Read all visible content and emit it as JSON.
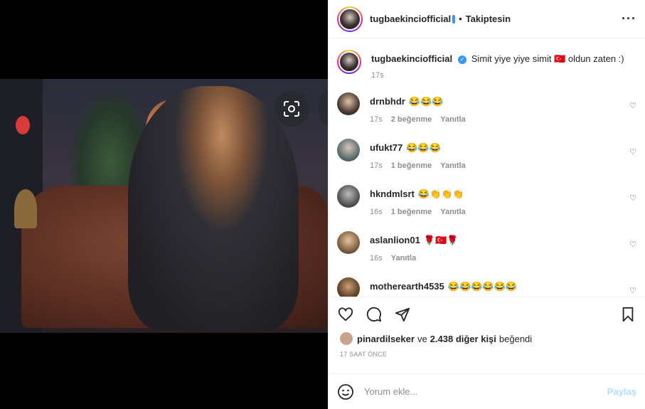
{
  "header": {
    "username": "tugbaekinciofficial",
    "follow_status": "Takiptesin",
    "separator": "•"
  },
  "caption": {
    "username": "tugbaekinciofficial",
    "text": "Simit yiye yiye simit 🇹🇷 oldun zaten :)",
    "time": "17s"
  },
  "comments": [
    {
      "username": "drnbhdr",
      "text": "😂😂😂",
      "time": "17s",
      "likes": "2 beğenme",
      "reply": "Yanıtla"
    },
    {
      "username": "ufukt77",
      "text": "😂😂😂",
      "time": "17s",
      "likes": "1 beğenme",
      "reply": "Yanıtla"
    },
    {
      "username": "hkndmlsrt",
      "text": "😂👏👏👏",
      "time": "16s",
      "likes": "1 beğenme",
      "reply": "Yanıtla"
    },
    {
      "username": "aslanlion01",
      "text": "🌹🇹🇷🌹",
      "time": "16s",
      "likes": "",
      "reply": "Yanıtla"
    },
    {
      "username": "motherearth4535",
      "text": "😂😂😂😂😂😂",
      "time": "",
      "likes": "",
      "reply": ""
    }
  ],
  "likes": {
    "user": "pinardilseker",
    "connector": "ve",
    "others": "2.438 diğer kişi",
    "suffix": "beğendi"
  },
  "time_ago": "17 SAAT ÖNCE",
  "comment_box": {
    "placeholder": "Yorum ekle...",
    "post_label": "Paylaş"
  },
  "colors": {
    "verified": "#3897f0",
    "post_disabled": "#b2dffc",
    "muted": "#8e8e8e"
  }
}
